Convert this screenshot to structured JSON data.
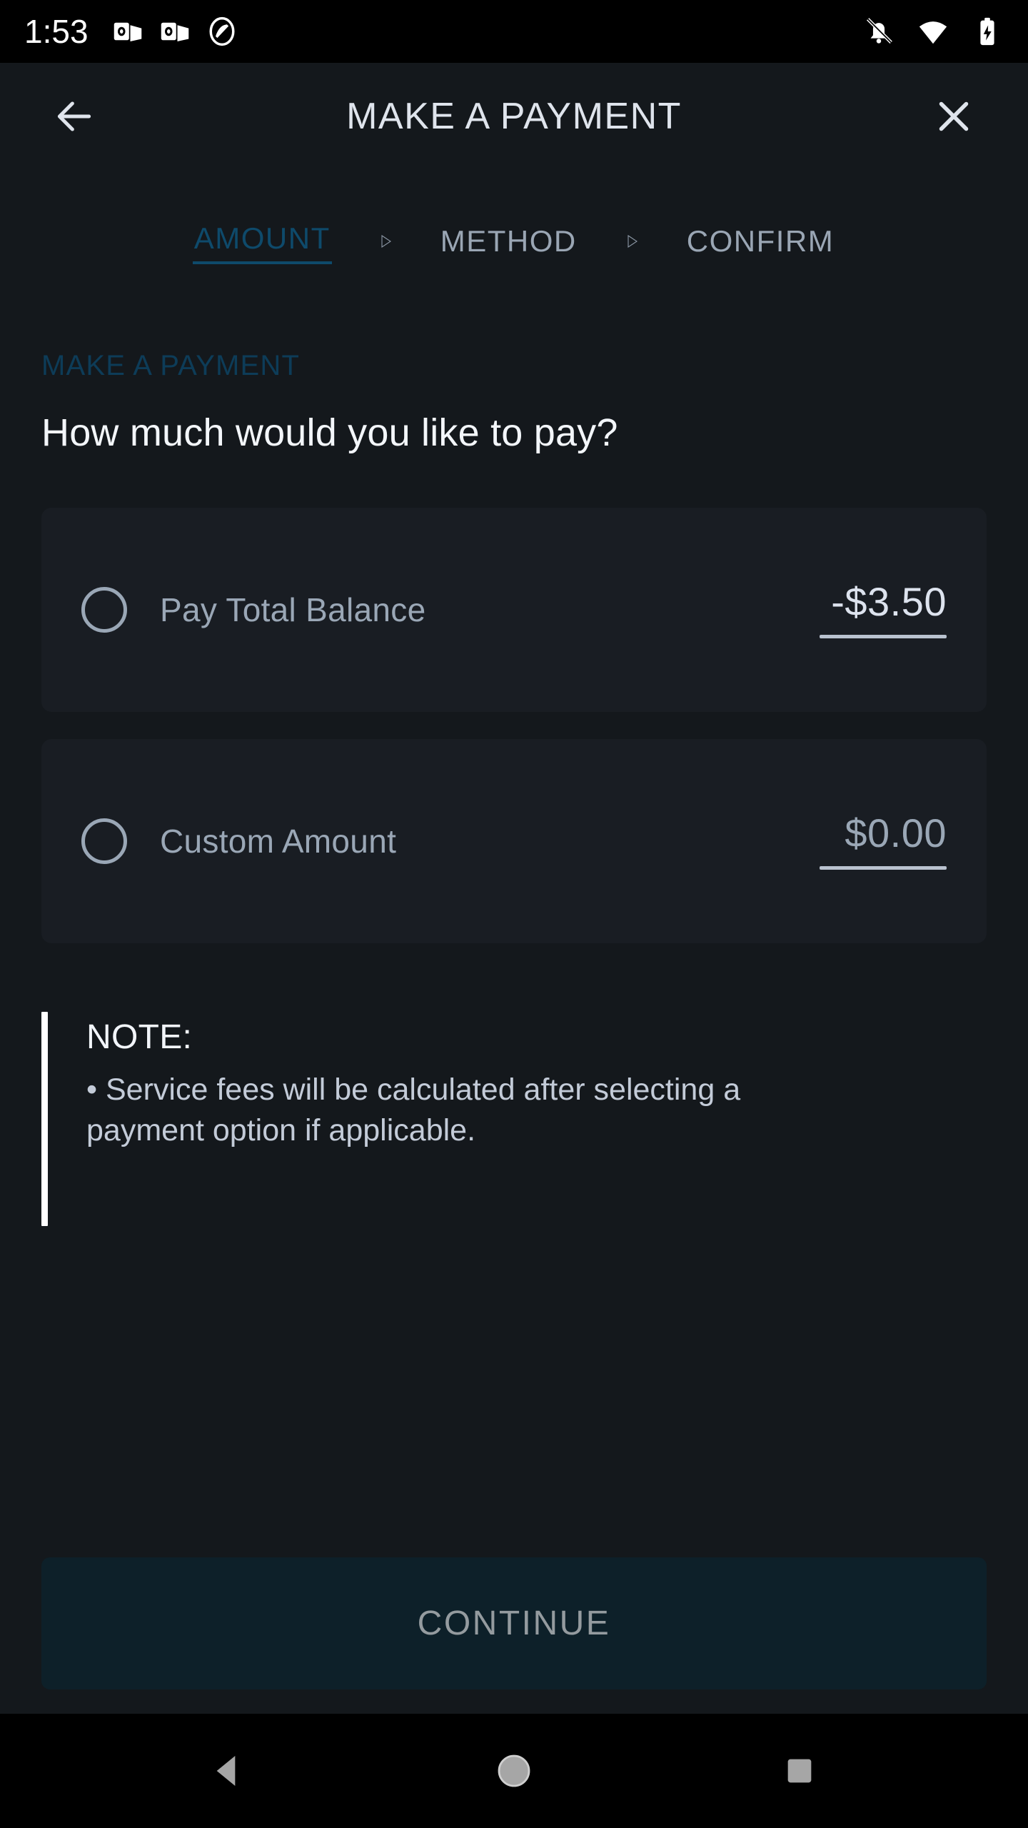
{
  "status_bar": {
    "clock": "1:53",
    "left_icons": [
      "outlook-icon",
      "outlook-icon",
      "do-not-disturb-icon"
    ],
    "right_icons": [
      "notifications-muted-icon",
      "wifi-icon",
      "battery-charging-icon"
    ]
  },
  "header": {
    "back_icon": "back-arrow-icon",
    "title": "MAKE A PAYMENT",
    "close_icon": "close-icon"
  },
  "stepper": {
    "separator_icon": "triangle-right-icon",
    "steps": [
      {
        "label": "AMOUNT",
        "state": "active"
      },
      {
        "label": "METHOD",
        "state": "inactive"
      },
      {
        "label": "CONFIRM",
        "state": "inactive"
      }
    ]
  },
  "main": {
    "section_label": "MAKE A PAYMENT",
    "headline": "How much would you like to pay?",
    "options": [
      {
        "radio_icon": "radio-unselected-icon",
        "label": "Pay Total Balance",
        "amount": "-$3.50",
        "selected": false
      },
      {
        "radio_icon": "radio-unselected-icon",
        "label": "Custom Amount",
        "amount": "$0.00",
        "placeholder": "$0.00",
        "selected": false
      }
    ],
    "note": {
      "title": "NOTE:",
      "text": "• Service fees will be calculated after selecting a payment option if applicable."
    }
  },
  "footer": {
    "continue_label": "CONTINUE"
  },
  "nav_bar": {
    "back_icon": "nav-back-triangle-icon",
    "home_icon": "nav-home-circle-icon",
    "recents_icon": "nav-recents-square-icon"
  },
  "colors": {
    "background": "#14181c",
    "card": "#191d23",
    "accent_blue": "#0e4a6b",
    "subtitle_blue": "#0d3c58",
    "muted_text": "#9aa7b6",
    "bright_text": "#dde3ee",
    "continue_bg": "#0d2029",
    "continue_text": "#949b9f",
    "status_bar": "#000000"
  }
}
